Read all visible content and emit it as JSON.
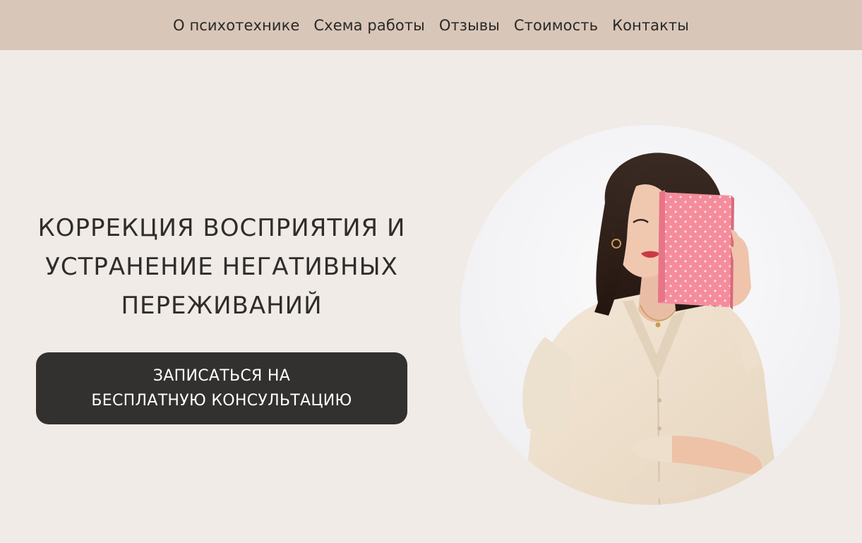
{
  "nav": {
    "items": [
      {
        "label": "О психотехнике"
      },
      {
        "label": "Схема работы"
      },
      {
        "label": "Отзывы"
      },
      {
        "label": "Стоимость"
      },
      {
        "label": "Контакты"
      }
    ]
  },
  "hero": {
    "title_lines": [
      "КОРРЕКЦИЯ ВОСПРИЯТИЯ И",
      "УСТРАНЕНИЕ НЕГАТИВНЫХ",
      "ПЕРЕЖИВАНИЙ"
    ],
    "cta_lines": [
      "ЗАПИСАТЬСЯ НА",
      "БЕСПЛАТНУЮ КОНСУЛЬТАЦИЮ"
    ]
  },
  "colors": {
    "page_background": "#f0ebe7",
    "nav_background": "#d8c6b8",
    "button_background": "#333130",
    "button_text": "#ffffff",
    "text": "#2f2d2b",
    "notebook": "#f58c9c"
  },
  "photo": {
    "icon": "woman-with-pink-notebook-photo"
  }
}
